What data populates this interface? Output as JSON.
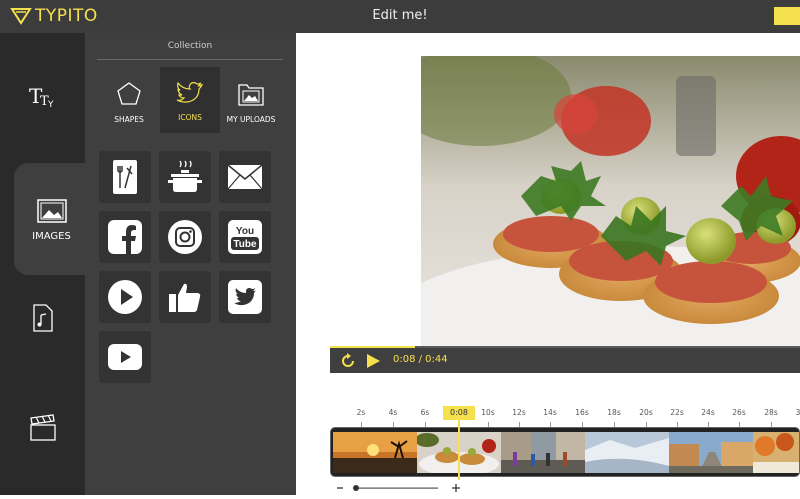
{
  "app": {
    "name": "TYPITO",
    "title": "Edit me!"
  },
  "colors": {
    "accent": "#f5e04e",
    "topbar": "#3c3c3c",
    "nav": "#2a2a2a",
    "panel": "#3f3f3f"
  },
  "nav": {
    "items": [
      {
        "icon": "text-icon",
        "label": ""
      },
      {
        "icon": "image-icon",
        "label": "IMAGES"
      },
      {
        "icon": "audio-file-icon",
        "label": ""
      },
      {
        "icon": "clapperboard-icon",
        "label": ""
      }
    ]
  },
  "panel": {
    "heading": "Collection",
    "tabs": [
      {
        "label": "SHAPES",
        "icon": "pentagon-icon"
      },
      {
        "label": "ICONS",
        "icon": "twitter-icon",
        "active": true
      },
      {
        "label": "MY UPLOADS",
        "icon": "folder-image-icon"
      }
    ],
    "icons": [
      "menu-card-icon",
      "cooking-pot-icon",
      "envelope-icon",
      "facebook-icon",
      "instagram-icon",
      "youtube-icon",
      "play-circle-icon",
      "thumbs-up-icon",
      "twitter-square-icon",
      "youtube-play-icon"
    ],
    "youtube_text": "You Tube"
  },
  "player": {
    "time": "0:08 / 0:44",
    "progress": 0.18
  },
  "timeline": {
    "cursor": "0:08",
    "ticks": [
      "2s",
      "4s",
      "6s",
      "10s",
      "12s",
      "14s",
      "16s",
      "18s",
      "20s",
      "22s",
      "24s",
      "26s",
      "28s",
      "3"
    ]
  }
}
